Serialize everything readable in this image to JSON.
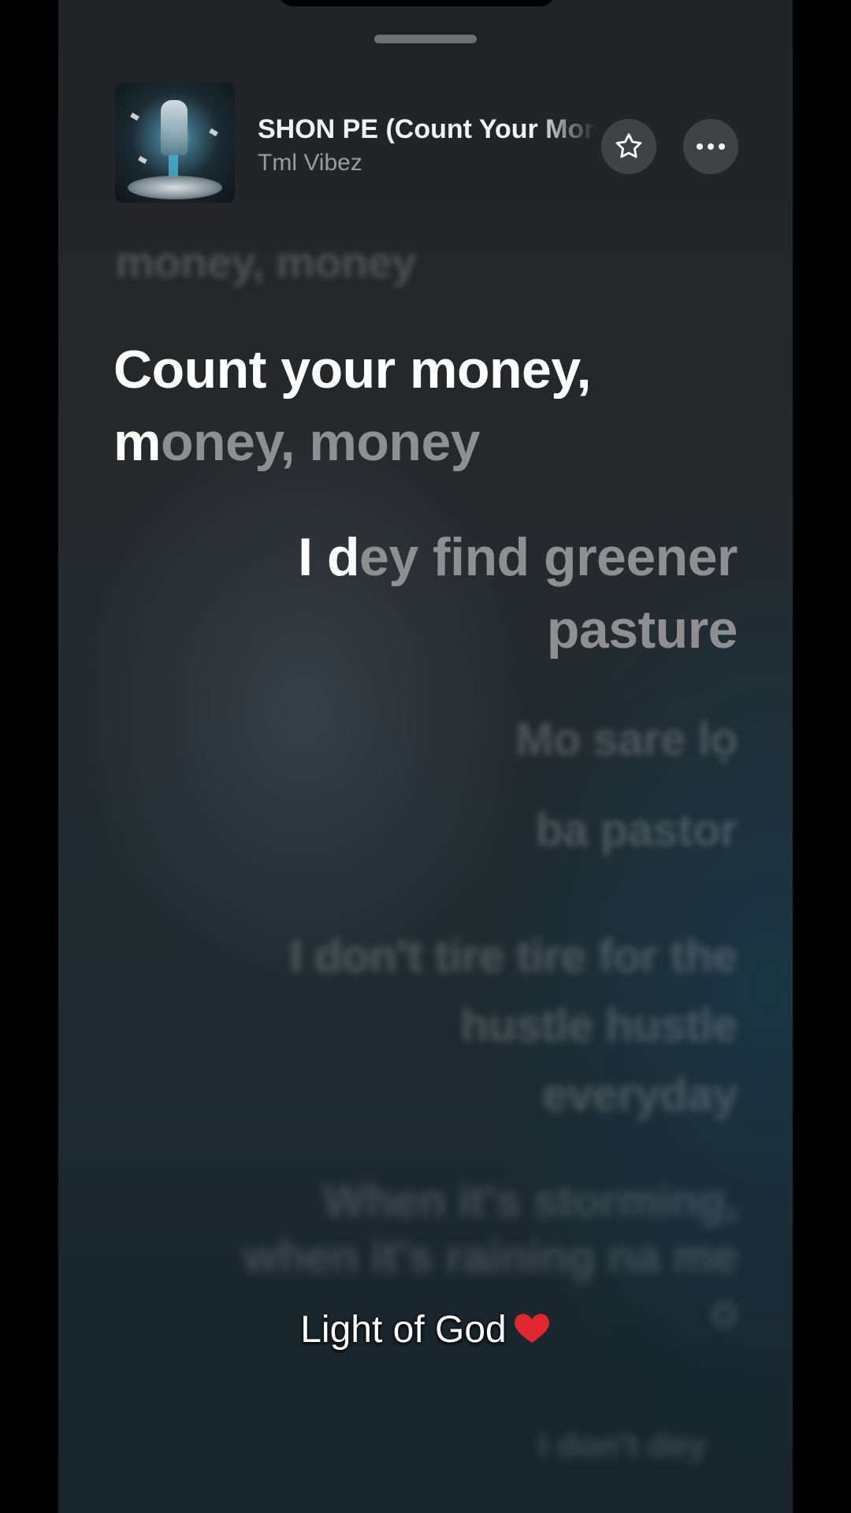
{
  "track": {
    "title": "SHON PE (Count Your Money)",
    "artist": "Tml Vibez"
  },
  "icons": {
    "favorite": "star-outline-icon",
    "more": "ellipsis-icon",
    "caption_emoji": "heart-icon"
  },
  "lyrics": {
    "previous": "money, money",
    "current_line1": "Count your money,",
    "current_line2_sung": "m",
    "current_line2_rest": "oney, money",
    "next_line1_sung": "I d",
    "next_line1_rest": "ey find greener",
    "next_line2": "pasture",
    "upcoming": [
      "Mo sare lọ",
      "ba pastor",
      "I don't tire tire for the hustle hustle everyday",
      "When it's storming, when it's raining na me o",
      "I don't dey"
    ]
  },
  "overlay": {
    "caption": "Light of God"
  },
  "colors": {
    "active_lyric": "#ffffff",
    "inactive_lyric": "#8e8f91",
    "heart": "#e0262f"
  }
}
